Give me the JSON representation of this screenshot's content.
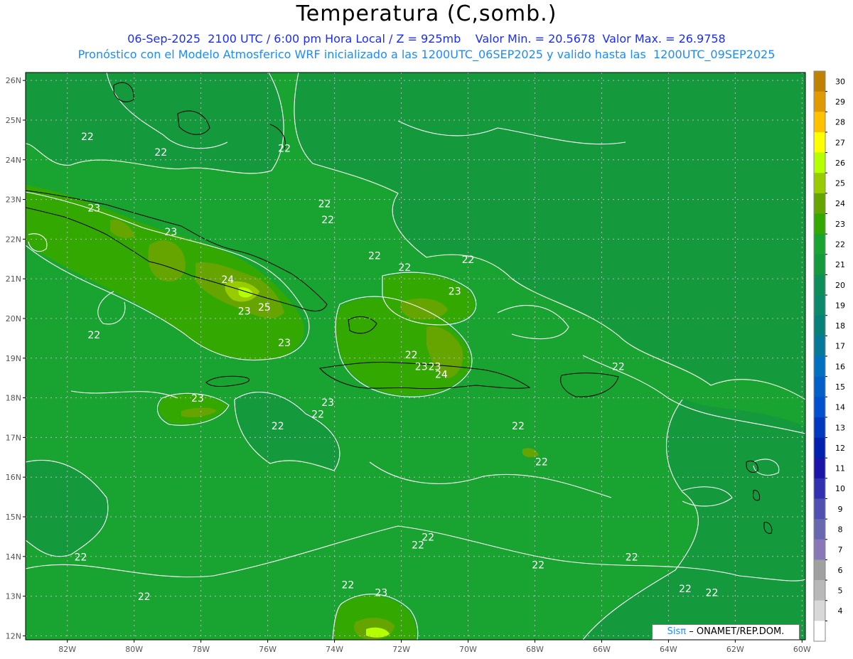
{
  "header": {
    "title": "Temperatura (C,somb.)",
    "date": "06-Sep-2025",
    "utc": "2100 UTC / 6:00 pm Hora Local / Z = 925mb",
    "vmin": "Valor Min. = 20.5678",
    "vmax": "Valor Max. = 26.9758",
    "model": "Pronóstico con el Modelo Atmosferico WRF inicializado a las 1200UTC_06SEP2025 y valido hasta las  1200UTC_09SEP2025"
  },
  "axes": {
    "lat_labels": [
      "26N",
      "25N",
      "24N",
      "23N",
      "22N",
      "21N",
      "20N",
      "19N",
      "18N",
      "17N",
      "16N",
      "15N",
      "14N",
      "13N",
      "12N"
    ],
    "lat_values": [
      26,
      25,
      24,
      23,
      22,
      21,
      20,
      19,
      18,
      17,
      16,
      15,
      14,
      13,
      12
    ],
    "lon_labels": [
      "82W",
      "80W",
      "78W",
      "76W",
      "74W",
      "72W",
      "70W",
      "68W",
      "66W",
      "64W",
      "62W",
      "60W"
    ],
    "lon_values": [
      -82,
      -80,
      -78,
      -76,
      -74,
      -72,
      -70,
      -68,
      -66,
      -64,
      -62,
      -60
    ]
  },
  "colorbar": {
    "labels": [
      "30",
      "29",
      "28",
      "27",
      "26",
      "25",
      "24",
      "23",
      "22",
      "21",
      "20",
      "19",
      "18",
      "17",
      "16",
      "15",
      "14",
      "13",
      "12",
      "11",
      "10",
      "9",
      "8",
      "7",
      "6",
      "5",
      "4"
    ],
    "colors": [
      "#c08000",
      "#e09a00",
      "#ffc000",
      "#ffff00",
      "#b4ff00",
      "#99cc00",
      "#66a500",
      "#33a800",
      "#19a330",
      "#14993c",
      "#0e8f5a",
      "#0a8a6a",
      "#07807a",
      "#06789a",
      "#0070c0",
      "#0060c8",
      "#0050d0",
      "#0038c0",
      "#0020b0",
      "#1a14a8",
      "#3030b0",
      "#5050b0",
      "#6868b0",
      "#8878b8",
      "#a0a0a0",
      "#b8b8b8",
      "#d8d8d8",
      "#ffffff"
    ]
  },
  "contour_labels": [
    {
      "text": "22",
      "lon": -81.4,
      "lat": 24.5
    },
    {
      "text": "22",
      "lon": -79.2,
      "lat": 24.1
    },
    {
      "text": "22",
      "lon": -75.5,
      "lat": 24.2
    },
    {
      "text": "23",
      "lon": -81.2,
      "lat": 22.7
    },
    {
      "text": "23",
      "lon": -78.9,
      "lat": 22.1
    },
    {
      "text": "22",
      "lon": -74.3,
      "lat": 22.8
    },
    {
      "text": "22",
      "lon": -74.2,
      "lat": 22.4
    },
    {
      "text": "22",
      "lon": -72.8,
      "lat": 21.5
    },
    {
      "text": "22",
      "lon": -71.9,
      "lat": 21.2
    },
    {
      "text": "22",
      "lon": -70.0,
      "lat": 21.4
    },
    {
      "text": "24",
      "lon": -77.2,
      "lat": 20.9
    },
    {
      "text": "23",
      "lon": -76.7,
      "lat": 20.1
    },
    {
      "text": "25",
      "lon": -76.1,
      "lat": 20.2
    },
    {
      "text": "23",
      "lon": -70.4,
      "lat": 20.6
    },
    {
      "text": "22",
      "lon": -81.2,
      "lat": 19.5
    },
    {
      "text": "23",
      "lon": -75.5,
      "lat": 19.3
    },
    {
      "text": "22",
      "lon": -71.7,
      "lat": 19.0
    },
    {
      "text": "23",
      "lon": -71.4,
      "lat": 18.7
    },
    {
      "text": "24",
      "lon": -70.8,
      "lat": 18.5
    },
    {
      "text": "23",
      "lon": -71.0,
      "lat": 18.7
    },
    {
      "text": "22",
      "lon": -65.5,
      "lat": 18.7
    },
    {
      "text": "23",
      "lon": -78.1,
      "lat": 17.9
    },
    {
      "text": "23",
      "lon": -74.2,
      "lat": 17.8
    },
    {
      "text": "22",
      "lon": -74.5,
      "lat": 17.5
    },
    {
      "text": "22",
      "lon": -75.7,
      "lat": 17.2
    },
    {
      "text": "22",
      "lon": -68.5,
      "lat": 17.2
    },
    {
      "text": "22",
      "lon": -67.8,
      "lat": 16.3
    },
    {
      "text": "22",
      "lon": -71.5,
      "lat": 14.2
    },
    {
      "text": "22",
      "lon": -71.2,
      "lat": 14.4
    },
    {
      "text": "22",
      "lon": -81.6,
      "lat": 13.9
    },
    {
      "text": "22",
      "lon": -67.9,
      "lat": 13.7
    },
    {
      "text": "22",
      "lon": -65.1,
      "lat": 13.9
    },
    {
      "text": "22",
      "lon": -73.6,
      "lat": 13.2
    },
    {
      "text": "23",
      "lon": -72.6,
      "lat": 13.0
    },
    {
      "text": "22",
      "lon": -79.7,
      "lat": 12.9
    },
    {
      "text": "22",
      "lon": -63.5,
      "lat": 13.1
    },
    {
      "text": "22",
      "lon": -62.7,
      "lat": 13.0
    }
  ],
  "credit": {
    "sis": "Sisπ",
    "rest": "– ONAMET/REP.DOM."
  }
}
